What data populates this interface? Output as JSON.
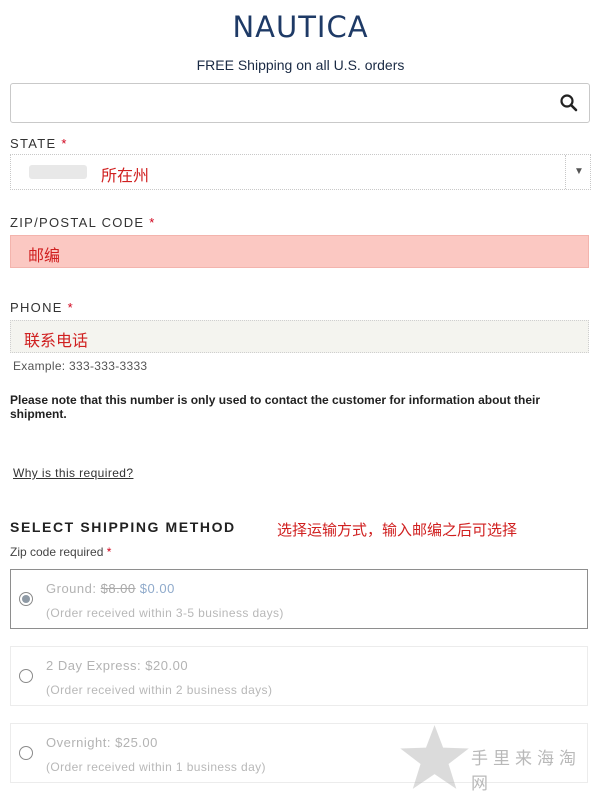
{
  "header": {
    "logo": "NAUTICA",
    "shipping_banner": "FREE Shipping on all U.S. orders"
  },
  "search": {
    "placeholder": "",
    "icon": "search-icon"
  },
  "state": {
    "label": "STATE",
    "required_mark": "*",
    "annotation": "所在州",
    "dropdown_icon": "caret-down-icon"
  },
  "zip": {
    "label": "ZIP/POSTAL CODE",
    "required_mark": "*",
    "annotation": "邮编",
    "error_bg_color": "#fbc8c2"
  },
  "phone": {
    "label": "PHONE",
    "required_mark": "*",
    "annotation": "联系电话",
    "example": "Example: 333-333-3333",
    "note": "Please note that this number is only used to contact the customer for information about their shipment.",
    "why_link": "Why is this required?"
  },
  "shipping": {
    "title": "SELECT SHIPPING METHOD",
    "annotation": "选择运输方式，输入邮编之后可选择",
    "zip_required": "Zip code required",
    "required_mark": "*",
    "options": [
      {
        "name": "Ground:",
        "old_price": "$8.00",
        "price": "$0.00",
        "note": "(Order received within 3-5 business days)",
        "selected": true
      },
      {
        "name": "2 Day Express:",
        "price": "$20.00",
        "note": "(Order received within 2 business days)",
        "selected": false
      },
      {
        "name": "Overnight:",
        "price": "$25.00",
        "note": "(Order received within 1 business day)",
        "selected": false
      }
    ]
  },
  "watermark": {
    "text": "手里来海淘网",
    "icon": "star-icon"
  },
  "colors": {
    "brand": "#1e3a66",
    "annotation_red": "#d02020",
    "required_red": "#d0021b"
  }
}
